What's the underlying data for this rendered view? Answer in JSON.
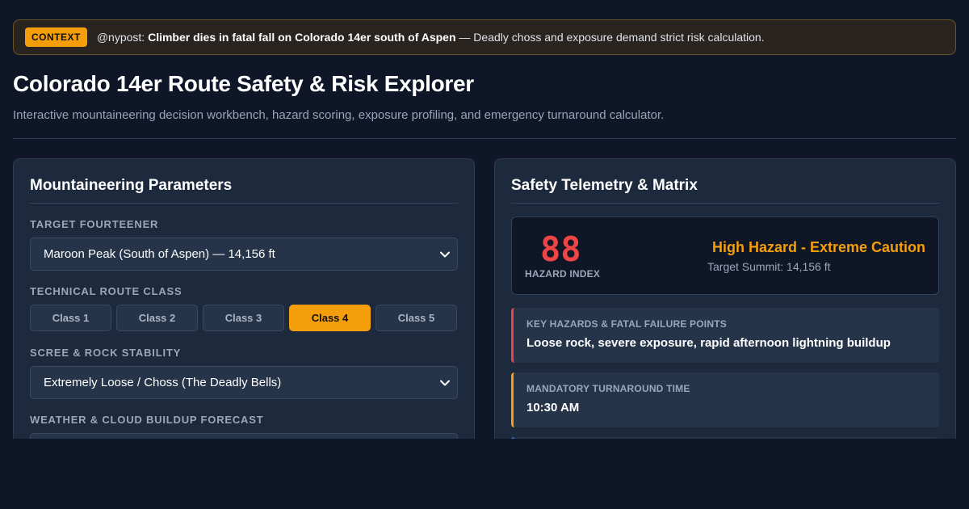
{
  "context": {
    "badge": "CONTEXT",
    "handle": "@nypost:",
    "headline": "Climber dies in fatal fall on Colorado 14er south of Aspen",
    "tail": "— Deadly choss and exposure demand strict risk calculation."
  },
  "page": {
    "title": "Colorado 14er Route Safety & Risk Explorer",
    "subtitle": "Interactive mountaineering decision workbench, hazard scoring, exposure profiling, and emergency turnaround calculator."
  },
  "params": {
    "title": "Mountaineering Parameters",
    "peak_label": "Target Fourteener",
    "peak_value": "Maroon Peak (South of Aspen) — 14,156 ft",
    "route_label": "Technical Route Class",
    "route_classes": [
      "Class 1",
      "Class 2",
      "Class 3",
      "Class 4",
      "Class 5"
    ],
    "route_selected": "Class 4",
    "scree_label": "Scree & Rock Stability",
    "scree_value": "Extremely Loose / Choss (The Deadly Bells)",
    "weather_label": "Weather & Cloud Buildup Forecast"
  },
  "telemetry": {
    "title": "Safety Telemetry & Matrix",
    "hazard_index": "88",
    "hazard_caption": "HAZARD INDEX",
    "hazard_level": "High Hazard - Extreme Caution",
    "target_summit": "Target Summit: 14,156 ft",
    "key_hazards_label": "Key Hazards & Fatal Failure Points",
    "key_hazards_value": "Loose rock, severe exposure, rapid afternoon lightning buildup",
    "turnaround_label": "Mandatory Turnaround Time",
    "turnaround_value": "10:30 AM"
  },
  "colors": {
    "accent": "#f59e0b",
    "danger": "#ef4444",
    "info": "#3b82f6",
    "background": "#0e1628",
    "panel": "#1d2a3e"
  },
  "icons": {
    "select_chevron": "chevron-down-icon"
  }
}
